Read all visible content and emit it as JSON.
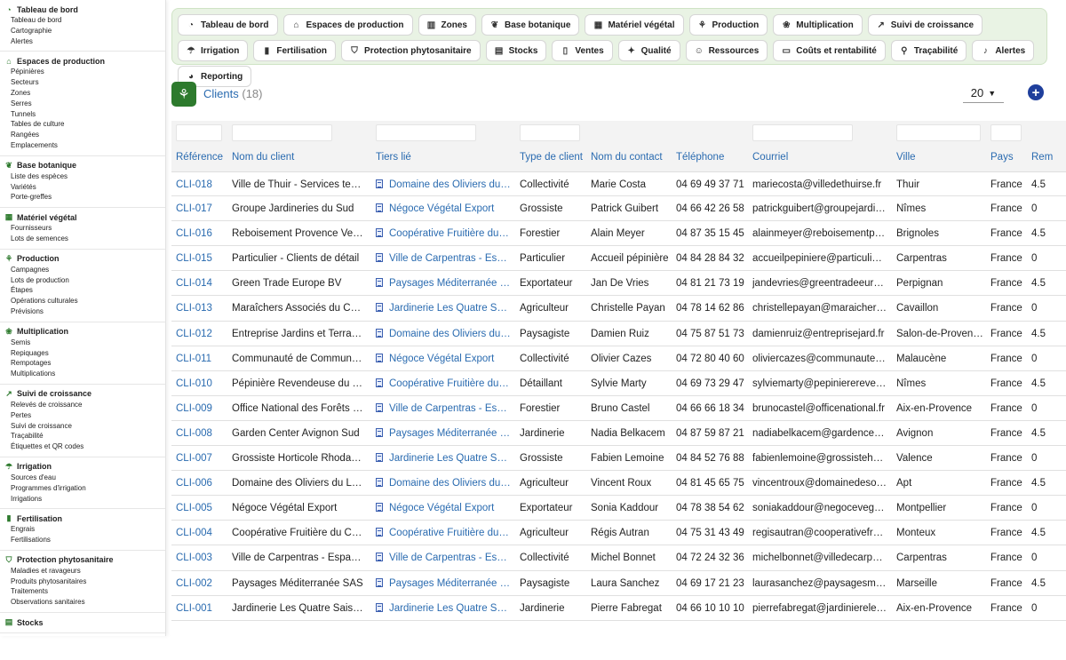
{
  "sidebar": [
    {
      "title": "Tableau de bord",
      "icon": "dashboard-icon",
      "items": [
        "Tableau de bord",
        "Cartographie",
        "Alertes"
      ]
    },
    {
      "title": "Espaces de production",
      "icon": "greenhouse-icon",
      "items": [
        "Pépinières",
        "Secteurs",
        "Zones",
        "Serres",
        "Tunnels",
        "Tables de culture",
        "Rangées",
        "Emplacements"
      ]
    },
    {
      "title": "Base botanique",
      "icon": "leaf-icon",
      "items": [
        "Liste des espèces",
        "Variétés",
        "Porte-greffes"
      ]
    },
    {
      "title": "Matériel végétal",
      "icon": "plant-material-icon",
      "items": [
        "Fournisseurs",
        "Lots de semences"
      ]
    },
    {
      "title": "Production",
      "icon": "seedling-icon",
      "items": [
        "Campagnes",
        "Lots de production",
        "Étapes",
        "Opérations culturales",
        "Prévisions"
      ]
    },
    {
      "title": "Multiplication",
      "icon": "multiplication-icon",
      "items": [
        "Semis",
        "Repiquages",
        "Rempotages",
        "Multiplications"
      ]
    },
    {
      "title": "Suivi de croissance",
      "icon": "growth-chart-icon",
      "items": [
        "Relevés de croissance",
        "Pertes",
        "Suivi de croissance",
        "Traçabilité",
        "Étiquettes et QR codes"
      ]
    },
    {
      "title": "Irrigation",
      "icon": "irrigation-icon",
      "items": [
        "Sources d'eau",
        "Programmes d'irrigation",
        "Irrigations"
      ]
    },
    {
      "title": "Fertilisation",
      "icon": "fertilizer-icon",
      "items": [
        "Engrais",
        "Fertilisations"
      ]
    },
    {
      "title": "Protection phytosanitaire",
      "icon": "shield-icon",
      "items": [
        "Maladies et ravageurs",
        "Produits phytosanitaires",
        "Traitements",
        "Observations sanitaires"
      ]
    },
    {
      "title": "Stocks",
      "icon": "stock-icon",
      "items": []
    }
  ],
  "topnav": [
    {
      "label": "Tableau de bord",
      "icon": "dashboard-icon"
    },
    {
      "label": "Espaces de production",
      "icon": "greenhouse-icon"
    },
    {
      "label": "Zones",
      "icon": "map-icon"
    },
    {
      "label": "Base botanique",
      "icon": "leaf-icon"
    },
    {
      "label": "Matériel végétal",
      "icon": "plant-material-icon"
    },
    {
      "label": "Production",
      "icon": "seedling-icon"
    },
    {
      "label": "Multiplication",
      "icon": "multiplication-icon"
    },
    {
      "label": "Suivi de croissance",
      "icon": "growth-chart-icon"
    },
    {
      "label": "Irrigation",
      "icon": "irrigation-icon"
    },
    {
      "label": "Fertilisation",
      "icon": "fertilizer-icon"
    },
    {
      "label": "Protection phytosanitaire",
      "icon": "shield-icon"
    },
    {
      "label": "Stocks",
      "icon": "stock-icon"
    },
    {
      "label": "Ventes",
      "icon": "sales-icon"
    },
    {
      "label": "Qualité",
      "icon": "quality-icon"
    },
    {
      "label": "Ressources",
      "icon": "people-icon"
    },
    {
      "label": "Coûts et rentabilité",
      "icon": "money-icon"
    },
    {
      "label": "Traçabilité",
      "icon": "traceability-icon"
    },
    {
      "label": "Alertes",
      "icon": "bell-icon"
    },
    {
      "label": "Reporting",
      "icon": "report-icon"
    }
  ],
  "page": {
    "title": "Clients",
    "count": "(18)",
    "page_size": "20",
    "add_label": "+",
    "brand_color": "#2d7a2d",
    "link_color": "#2a6bb0"
  },
  "columns": [
    "Référence",
    "Nom du client",
    "Tiers lié",
    "Type de client",
    "Nom du contact",
    "Téléphone",
    "Courriel",
    "Ville",
    "Pays",
    "Rem"
  ],
  "rows": [
    [
      "CLI-018",
      "Ville de Thuir - Services tec…",
      "Domaine des Oliviers du…",
      "Collectivité",
      "Marie Costa",
      "04 69 49 37 71",
      "mariecosta@villedethuirse.fr",
      "Thuir",
      "France",
      "4.5"
    ],
    [
      "CLI-017",
      "Groupe Jardineries du Sud",
      "Négoce Végétal Export",
      "Grossiste",
      "Patrick Guibert",
      "04 66 42 26 58",
      "patrickguibert@groupejardin…",
      "Nîmes",
      "France",
      "0"
    ],
    [
      "CLI-016",
      "Reboisement Provence Verte",
      "Coopérative Fruitière du …",
      "Forestier",
      "Alain Meyer",
      "04 87 35 15 45",
      "alainmeyer@reboisementpr…",
      "Brignoles",
      "France",
      "4.5"
    ],
    [
      "CLI-015",
      "Particulier - Clients de détail",
      "Ville de Carpentras - Esp…",
      "Particulier",
      "Accueil pépinière",
      "04 84 28 84 32",
      "accueilpepiniere@particulier…",
      "Carpentras",
      "France",
      "0"
    ],
    [
      "CLI-014",
      "Green Trade Europe BV",
      "Paysages Méditerranée …",
      "Exportateur",
      "Jan De Vries",
      "04 81 21 73 19",
      "jandevries@greentradeeuro.fr",
      "Perpignan",
      "France",
      "4.5"
    ],
    [
      "CLI-013",
      "Maraîchers Associés du Co…",
      "Jardinerie Les Quatre S…",
      "Agriculteur",
      "Christelle Payan",
      "04 78 14 62 86",
      "christellepayan@maraicher…",
      "Cavaillon",
      "France",
      "0"
    ],
    [
      "CLI-012",
      "Entreprise Jardins et Terras…",
      "Domaine des Oliviers du…",
      "Paysagiste",
      "Damien Ruiz",
      "04 75 87 51 73",
      "damienruiz@entreprisejard.fr",
      "Salon-de-Provence",
      "France",
      "4.5"
    ],
    [
      "CLI-011",
      "Communauté de Commune…",
      "Négoce Végétal Export",
      "Collectivité",
      "Olivier Cazes",
      "04 72 80 40 60",
      "oliviercazes@communauted…",
      "Malaucène",
      "France",
      "0"
    ],
    [
      "CLI-010",
      "Pépinière Revendeuse du G…",
      "Coopérative Fruitière du …",
      "Détaillant",
      "Sylvie Marty",
      "04 69 73 29 47",
      "sylviemarty@pepinierereven.fr",
      "Nîmes",
      "France",
      "4.5"
    ],
    [
      "CLI-009",
      "Office National des Forêts - …",
      "Ville de Carpentras - Esp…",
      "Forestier",
      "Bruno Castel",
      "04 66 66 18 34",
      "brunocastel@officenational.fr",
      "Aix-en-Provence",
      "France",
      "0"
    ],
    [
      "CLI-008",
      "Garden Center Avignon Sud",
      "Paysages Méditerranée …",
      "Jardinerie",
      "Nadia Belkacem",
      "04 87 59 87 21",
      "nadiabelkacem@gardencen…",
      "Avignon",
      "France",
      "4.5"
    ],
    [
      "CLI-007",
      "Grossiste Horticole Rhodanien",
      "Jardinerie Les Quatre S…",
      "Grossiste",
      "Fabien Lemoine",
      "04 84 52 76 88",
      "fabienlemoine@grossisteho…",
      "Valence",
      "France",
      "0"
    ],
    [
      "CLI-006",
      "Domaine des Oliviers du Lu…",
      "Domaine des Oliviers du…",
      "Agriculteur",
      "Vincent Roux",
      "04 81 45 65 75",
      "vincentroux@domainedesoli…",
      "Apt",
      "France",
      "4.5"
    ],
    [
      "CLI-005",
      "Négoce Végétal Export",
      "Négoce Végétal Export",
      "Exportateur",
      "Sonia Kaddour",
      "04 78 38 54 62",
      "soniakaddour@negocevege…",
      "Montpellier",
      "France",
      "0"
    ],
    [
      "CLI-004",
      "Coopérative Fruitière du Co…",
      "Coopérative Fruitière du …",
      "Agriculteur",
      "Régis Autran",
      "04 75 31 43 49",
      "regisautran@cooperativefru.fr",
      "Monteux",
      "France",
      "4.5"
    ],
    [
      "CLI-003",
      "Ville de Carpentras - Espac…",
      "Ville de Carpentras - Esp…",
      "Collectivité",
      "Michel Bonnet",
      "04 72 24 32 36",
      "michelbonnet@villedecarpe…",
      "Carpentras",
      "France",
      "0"
    ],
    [
      "CLI-002",
      "Paysages Méditerranée SAS",
      "Paysages Méditerranée …",
      "Paysagiste",
      "Laura Sanchez",
      "04 69 17 21 23",
      "laurasanchez@paysagesm…",
      "Marseille",
      "France",
      "4.5"
    ],
    [
      "CLI-001",
      "Jardinerie Les Quatre Saisons",
      "Jardinerie Les Quatre S…",
      "Jardinerie",
      "Pierre Fabregat",
      "04 66 10 10 10",
      "pierrefabregat@jardinierele…",
      "Aix-en-Provence",
      "France",
      "0"
    ]
  ]
}
